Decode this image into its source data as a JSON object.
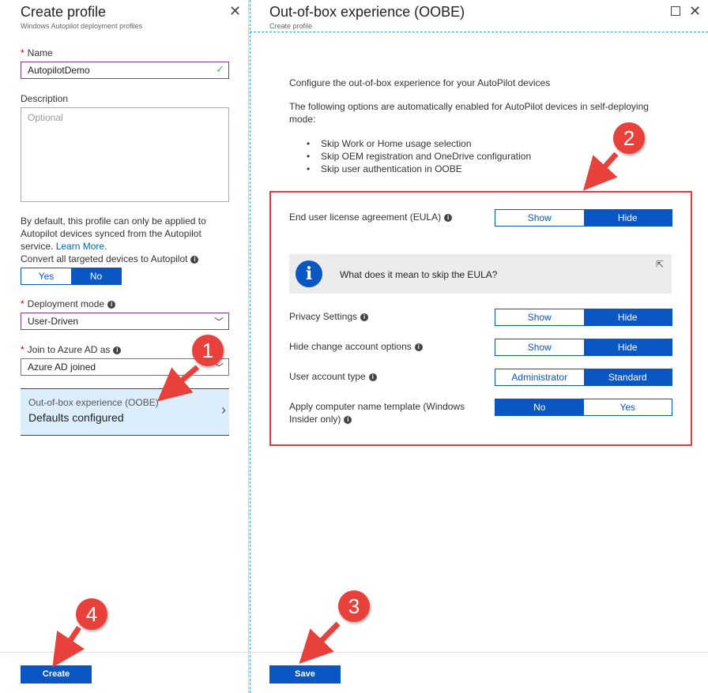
{
  "left_blade": {
    "title": "Create profile",
    "subtitle": "Windows Autopilot deployment profiles",
    "name_label": "Name",
    "name_value": "AutopilotDemo",
    "description_label": "Description",
    "description_placeholder": "Optional",
    "info_text": "By default, this profile can only be applied to Autopilot devices synced from the Autopilot service.",
    "learn_more": "Learn More.",
    "convert_label": "Convert all targeted devices to Autopilot",
    "convert_yes": "Yes",
    "convert_no": "No",
    "convert_selected": "No",
    "deployment_mode_label": "Deployment mode",
    "deployment_mode_value": "User-Driven",
    "join_label": "Join to Azure AD as",
    "join_value": "Azure AD joined",
    "oobe_item_title": "Out-of-box experience (OOBE)",
    "oobe_item_status": "Defaults configured",
    "create_button": "Create"
  },
  "right_blade": {
    "title": "Out-of-box experience (OOBE)",
    "subtitle": "Create profile",
    "intro": "Configure the out-of-box experience for your AutoPilot devices",
    "auto_enabled_text": "The following options are automatically enabled for AutoPilot devices in self-deploying mode:",
    "bullets": [
      "Skip Work or Home usage selection",
      "Skip OEM registration and OneDrive configuration",
      "Skip user authentication in OOBE"
    ],
    "settings": {
      "eula": {
        "label": "End user license agreement (EULA)",
        "left": "Show",
        "right": "Hide",
        "selected": "Hide"
      },
      "eula_info": "What does it mean to skip the EULA?",
      "privacy": {
        "label": "Privacy Settings",
        "left": "Show",
        "right": "Hide",
        "selected": "Hide"
      },
      "hide_account": {
        "label": "Hide change account options",
        "left": "Show",
        "right": "Hide",
        "selected": "Hide"
      },
      "user_type": {
        "label": "User account type",
        "left": "Administrator",
        "right": "Standard",
        "selected": "Standard"
      },
      "computer_name": {
        "label_line1": "Apply computer name template (Windows",
        "label_line2": "Insider only)",
        "left": "No",
        "right": "Yes",
        "selected": "No"
      }
    },
    "save_button": "Save"
  },
  "callouts": [
    "1",
    "2",
    "3",
    "4"
  ],
  "colors": {
    "accent": "#0a56c2",
    "callout": "#e8403a",
    "highlight_box": "#e0393e",
    "selected_item_bg": "#dceefb"
  }
}
